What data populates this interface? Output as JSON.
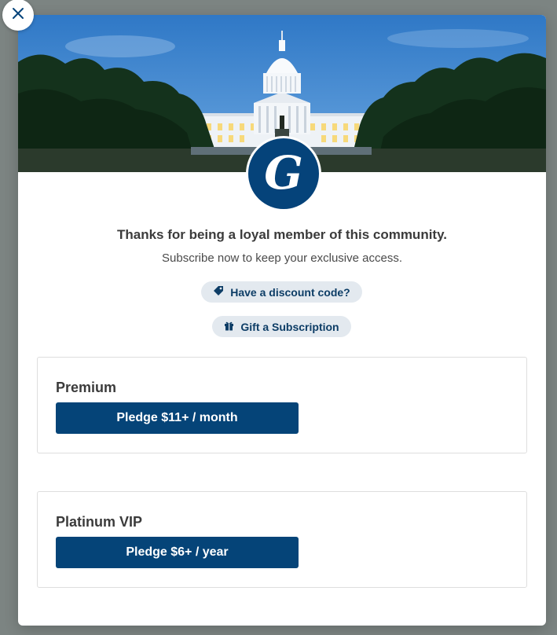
{
  "close": {
    "icon": "close-icon"
  },
  "hero": {
    "image": "us-capitol-building-photo"
  },
  "logo": {
    "letter": "G",
    "icon": "publication-logo"
  },
  "headline": "Thanks for being a loyal member of this community.",
  "subline": "Subscribe now to keep your exclusive access.",
  "discount": {
    "label": "Have a discount code?",
    "icon": "tag-icon"
  },
  "gift": {
    "label": "Gift a Subscription",
    "icon": "gift-icon"
  },
  "tiers": [
    {
      "name": "Premium",
      "button": "Pledge $11+ / month"
    },
    {
      "name": "Platinum VIP",
      "button": "Pledge $6+ / year"
    }
  ],
  "colors": {
    "primary": "#054478",
    "pill_bg": "#e3e9ef",
    "overlay": "#7c8482"
  }
}
